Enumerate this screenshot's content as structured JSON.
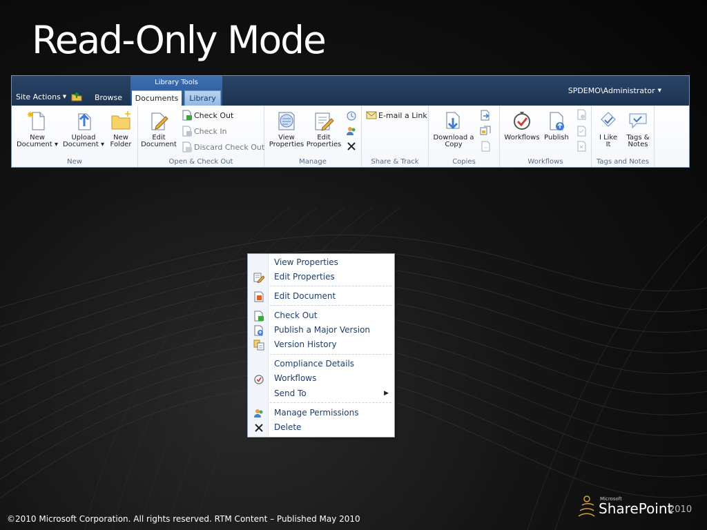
{
  "slide": {
    "title": "Read-Only Mode",
    "footer": "©2010 Microsoft Corporation. All rights reserved. RTM Content – Published May 2010"
  },
  "logo": {
    "microsoft": "Microsoft",
    "product": "SharePoint",
    "version": "2010"
  },
  "ribbon": {
    "context_group": "Library Tools",
    "site_actions": "Site Actions",
    "tabs": [
      "Browse",
      "Documents",
      "Library"
    ],
    "user": "SPDEMO\\Administrator",
    "groups": {
      "new": {
        "label": "New",
        "new_document": [
          "New",
          "Document"
        ],
        "upload_document": [
          "Upload",
          "Document"
        ],
        "new_folder": [
          "New",
          "Folder"
        ]
      },
      "open": {
        "label": "Open & Check Out",
        "edit_document": [
          "Edit",
          "Document"
        ],
        "check_out": "Check Out",
        "check_in": "Check In",
        "discard_check_out": "Discard Check Out"
      },
      "manage": {
        "label": "Manage",
        "view_properties": [
          "View",
          "Properties"
        ],
        "edit_properties": [
          "Edit",
          "Properties"
        ]
      },
      "share": {
        "label": "Share & Track",
        "email_link": "E-mail a Link"
      },
      "copies": {
        "label": "Copies",
        "download_copy": [
          "Download a",
          "Copy"
        ]
      },
      "workflows": {
        "label": "Workflows",
        "workflows": "Workflows",
        "publish": "Publish"
      },
      "tags": {
        "label": "Tags and Notes",
        "i_like_it": [
          "I Like",
          "It"
        ],
        "tags_notes": [
          "Tags &",
          "Notes"
        ]
      }
    }
  },
  "context_menu": {
    "items": [
      "View Properties",
      "Edit Properties",
      "Edit Document",
      "Check Out",
      "Publish a Major Version",
      "Version History",
      "Compliance Details",
      "Workflows",
      "Send To",
      "Manage Permissions",
      "Delete"
    ]
  }
}
